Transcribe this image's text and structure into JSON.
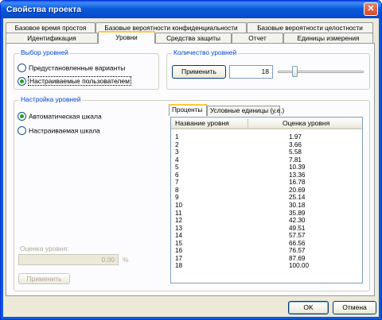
{
  "window": {
    "title": "Свойства проекта",
    "close_glyph": "✕"
  },
  "tabs_row1": [
    {
      "label": "Базовое время простоя"
    },
    {
      "label": "Базовые вероятности конфиденциальности"
    },
    {
      "label": "Базовые вероятности целостности"
    }
  ],
  "tabs_row2": [
    {
      "label": "Идентификация"
    },
    {
      "label": "Уровни",
      "active": true
    },
    {
      "label": "Средства защиты"
    },
    {
      "label": "Отчет"
    },
    {
      "label": "Единицы измерения"
    }
  ],
  "level_choice": {
    "title": "Выбор уровней",
    "options": [
      {
        "label": "Предустановленные варианты",
        "checked": false
      },
      {
        "label": "Настраиваемые пользователем",
        "checked": true
      }
    ]
  },
  "level_count": {
    "title": "Количество уровней",
    "apply_label": "Применить",
    "value": "18",
    "slider_value": 18
  },
  "level_setup": {
    "title": "Настройка уровней",
    "options": [
      {
        "label": "Автоматическая шкала",
        "checked": true
      },
      {
        "label": "Настраиваемая шкала",
        "checked": false
      }
    ],
    "rating_label": "Оценка уровня:",
    "rating_value": "0.00",
    "rating_unit": "%",
    "apply_label": "Применить"
  },
  "inner_tabs": [
    {
      "label": "Проценты",
      "active": true
    },
    {
      "label": "Условные единицы (у.е.)"
    }
  ],
  "table": {
    "columns": [
      "Название уровня",
      "Оценка уровня"
    ],
    "rows": [
      [
        "1",
        "1.97"
      ],
      [
        "2",
        "3.66"
      ],
      [
        "3",
        "5.58"
      ],
      [
        "4",
        "7.81"
      ],
      [
        "5",
        "10.39"
      ],
      [
        "6",
        "13.36"
      ],
      [
        "7",
        "16.78"
      ],
      [
        "8",
        "20.69"
      ],
      [
        "9",
        "25.14"
      ],
      [
        "10",
        "30.18"
      ],
      [
        "11",
        "35.89"
      ],
      [
        "12",
        "42.30"
      ],
      [
        "13",
        "49.51"
      ],
      [
        "14",
        "57.57"
      ],
      [
        "15",
        "66.56"
      ],
      [
        "16",
        "76.57"
      ],
      [
        "17",
        "87.69"
      ],
      [
        "18",
        "100.00"
      ]
    ]
  },
  "footer": {
    "ok_label": "OK",
    "cancel_label": "Отмена"
  }
}
